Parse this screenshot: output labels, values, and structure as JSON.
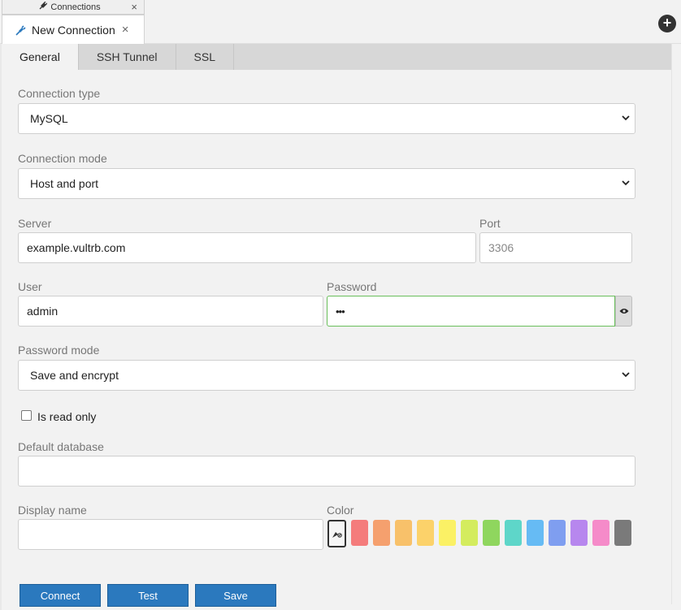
{
  "tabs": {
    "mini_tab_label": "Connections",
    "main_tab_label": "New Connection",
    "close_glyph": "×",
    "add_glyph": "+"
  },
  "subtabs": [
    "General",
    "SSH Tunnel",
    "SSL"
  ],
  "form": {
    "connection_type_label": "Connection type",
    "connection_type_value": "MySQL",
    "connection_mode_label": "Connection mode",
    "connection_mode_value": "Host and port",
    "server_label": "Server",
    "server_value": "example.vultrb.com",
    "port_label": "Port",
    "port_placeholder": "3306",
    "user_label": "User",
    "user_value": "admin",
    "password_label": "Password",
    "password_value": "•••",
    "password_mode_label": "Password mode",
    "password_mode_value": "Save and encrypt",
    "read_only_label": "Is read only",
    "read_only_checked": false,
    "default_database_label": "Default database",
    "default_database_value": "",
    "display_name_label": "Display name",
    "display_name_value": "",
    "color_label": "Color",
    "colors": [
      "#f47c7c",
      "#f5a06e",
      "#f8c16a",
      "#fcd26a",
      "#fbf165",
      "#d4ec5e",
      "#8fd65e",
      "#5ed6c9",
      "#66bbf4",
      "#7f9ef0",
      "#b787ee",
      "#f58bc9",
      "#7a7a7a"
    ]
  },
  "buttons": {
    "connect": "Connect",
    "test": "Test",
    "save": "Save"
  },
  "icons": {
    "tab_icon": "plug-icon",
    "eye": "eye-icon",
    "picker": "color-picker-icon",
    "select_arrow": "chevron-down-icon"
  }
}
